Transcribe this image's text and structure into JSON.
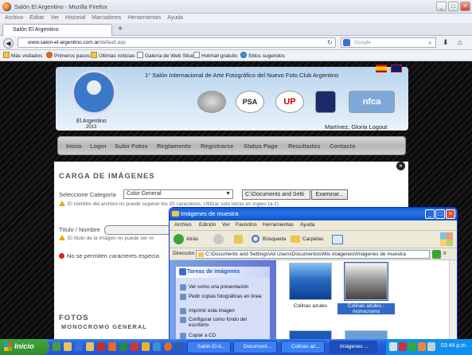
{
  "browser": {
    "window_title": "Salón El Argentino - Mozilla Firefox",
    "menu": [
      "Archivo",
      "Editar",
      "Ver",
      "Historial",
      "Marcadores",
      "Herramientas",
      "Ayuda"
    ],
    "tab_label": "Salón El Argentino",
    "url_domain": "www.salon-el-argentino.com.ar",
    "url_path": "/default.asp",
    "search_placeholder": "Google",
    "bookmarks": [
      "Más visitados",
      "Primeros pasos",
      "Últimas noticias",
      "Galería de Web Slice",
      "Hotmail gratuito",
      "Sitios sugeridos"
    ]
  },
  "site": {
    "banner_title": "1° Salón Internacional de Arte Fotográfico del Nuevo Foto Club Argentino",
    "logo_name": "El Argentino",
    "logo_year": "2013",
    "user": "Martínez, Gloria Logout",
    "nav": [
      "Inicio",
      "Login",
      "Subir Fotos",
      "Reglamento",
      "Registrarse",
      "Status Page",
      "Resultados",
      "Contacto"
    ]
  },
  "form": {
    "heading": "CARGA DE IMÁGENES",
    "category_label": "Seleccione Categoría",
    "category_value": "Color General",
    "file_value": "C:\\Documents and Setti",
    "browse_label": "Examinar...",
    "warn_filename": "El nombre del archivo no puede superar los 20 caracteres. Utilizar solo letras en ingles (a-z).",
    "title_label": "Título / Nombre",
    "warn_title": "El título de la imágen no puede ser re",
    "no_special": "No se permiten caracteres especia",
    "section": "FOTOS",
    "section_sub": "MONOCROMO GENERAL"
  },
  "explorer": {
    "title": "Imágenes de muestra",
    "menu": [
      "Archivo",
      "Edición",
      "Ver",
      "Favoritos",
      "Herramientas",
      "Ayuda"
    ],
    "back": "Atrás",
    "search": "Búsqueda",
    "folders": "Carpetas",
    "address_label": "Dirección",
    "address": "C:\\Documents and Settings\\All Users\\Documentos\\Mis imágenes\\Imágenes de muestra",
    "go": "Ir",
    "task_header": "Tareas de imágenes",
    "tasks": [
      "Ver como una presentación",
      "Pedir copias fotográficas en línea",
      "Imprimir esta imagen",
      "Configurar como fondo del escritorio",
      "Copiar a CD"
    ],
    "files": [
      "Colinas azules",
      "Colinas azules - monocromo"
    ]
  },
  "taskbar": {
    "start": "Inicio",
    "buttons": [
      "Salón El A...",
      "Document...",
      "Colinas az...",
      "Imágenes ..."
    ],
    "clock": "03:44 p.m."
  }
}
